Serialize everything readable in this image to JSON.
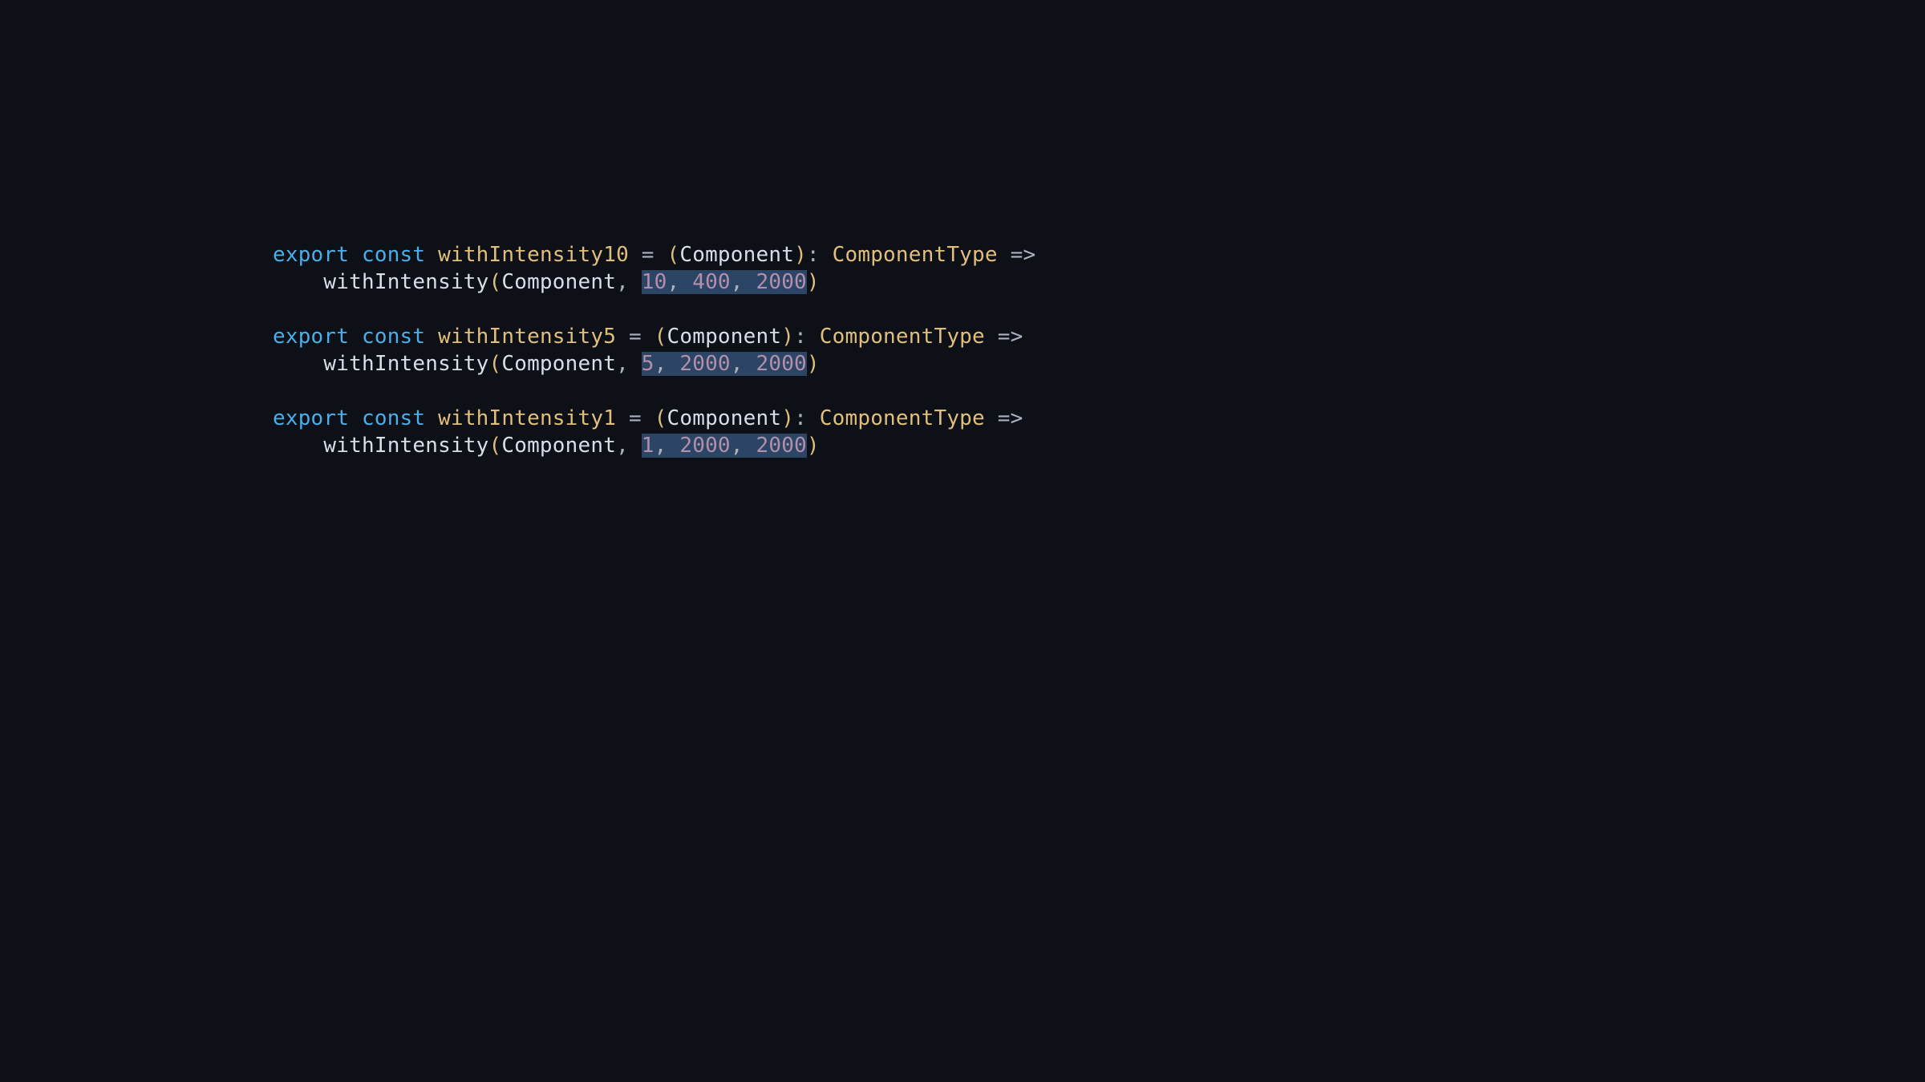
{
  "kw": {
    "export": "export",
    "const": "const"
  },
  "fn": {
    "name10": "withIntensity10",
    "name5": "withIntensity5",
    "name1": "withIntensity1",
    "call": "withIntensity"
  },
  "ident": {
    "component": "Component"
  },
  "type": {
    "componentType": "ComponentType"
  },
  "op": {
    "eq": "=",
    "colon": ":",
    "arrow": "=>",
    "lparen": "(",
    "rparen": ")",
    "comma": ","
  },
  "args": {
    "a10": {
      "n1": "10",
      "n2": "400",
      "n3": "2000"
    },
    "a5": {
      "n1": "5",
      "n2": "2000",
      "n3": "2000"
    },
    "a1": {
      "n1": "1",
      "n2": "2000",
      "n3": "2000"
    }
  }
}
